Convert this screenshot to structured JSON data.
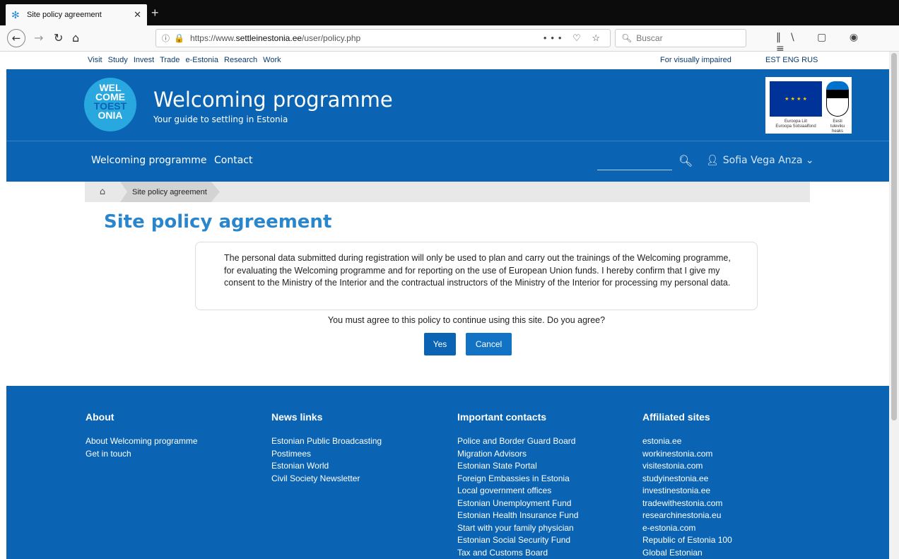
{
  "browser": {
    "tab_title": "Site policy agreement",
    "tab_close": "✕",
    "new_tab": "+",
    "url_prefix": "https://www.",
    "url_domain": "settleinestonia.ee",
    "url_path": "/user/policy.php",
    "search_placeholder": "Buscar",
    "url_tools": "••• ♡ ☆",
    "right_icons": "‖\\ ▢ ◉ ≡"
  },
  "topnav": {
    "links": [
      "Visit",
      "Study",
      "Invest",
      "Trade",
      "e-Estonia",
      "Research",
      "Work"
    ],
    "visually_impaired": "For visually impaired",
    "languages": "EST ENG RUS"
  },
  "header": {
    "logo_line1": "WEL",
    "logo_line2": "COME",
    "logo_line3": "TOEST",
    "logo_line4": "ONIA",
    "title": "Welcoming programme",
    "subtitle": "Your guide to settling in Estonia",
    "eu_caption": "Euroopa Liit\nEuroopa Sotsiaalfond",
    "ee_caption": "Eesti\ntuleviku heaks"
  },
  "mainnav": {
    "item1": "Welcoming programme",
    "item2": "Contact",
    "user": "Sofia Vega Anza ⌄"
  },
  "breadcrumb": {
    "current": "Site policy agreement"
  },
  "page": {
    "title": "Site policy agreement",
    "policy_text": "The personal data submitted during registration will only be used to plan and carry out the trainings of the Welcoming programme, for evaluating the Welcoming programme and for reporting on the use of European Union funds. I hereby confirm that I give my consent to the Ministry of the Interior and the contractual instructors of the Ministry of the Interior for processing my personal data.",
    "question": "You must agree to this policy to continue using this site. Do you agree?",
    "yes_label": "Yes",
    "cancel_label": "Cancel"
  },
  "footer": {
    "about": {
      "heading": "About",
      "links": [
        "About Welcoming programme",
        "Get in touch"
      ]
    },
    "news": {
      "heading": "News links",
      "links": [
        "Estonian Public Broadcasting",
        "Postimees",
        "Estonian World",
        "Civil Society Newsletter"
      ]
    },
    "contacts": {
      "heading": "Important contacts",
      "links": [
        "Police and Border Guard Board",
        "Migration Advisors",
        "Estonian State Portal",
        "Foreign Embassies in Estonia",
        "Local government offices",
        "Estonian Unemployment Fund",
        "Estonian Health Insurance Fund",
        "Start with your family physician",
        "Estonian Social Security Fund",
        "Tax and Customs Board"
      ]
    },
    "affiliated": {
      "heading": "Affiliated sites",
      "links": [
        "estonia.ee",
        "workinestonia.com",
        "visitestonia.com",
        "studyinestonia.ee",
        "investinestonia.ee",
        "tradewithestonia.com",
        "researchinestonia.eu",
        "e-estonia.com",
        "Republic of Estonia 100",
        "Global Estonian"
      ]
    }
  },
  "colors": {
    "brand_blue": "#0a64b3",
    "title_blue": "#2a86cc"
  }
}
